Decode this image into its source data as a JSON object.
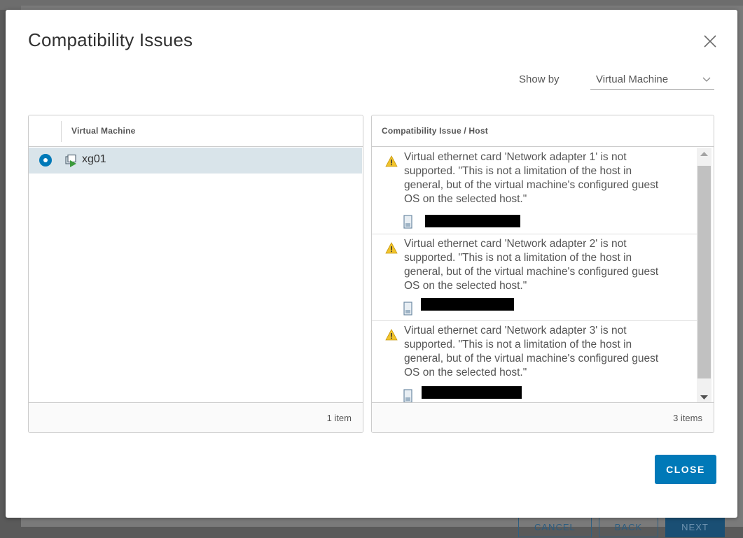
{
  "background": {
    "buttons": [
      "CANCEL",
      "BACK",
      "NEXT"
    ]
  },
  "dialog": {
    "title": "Compatibility Issues",
    "show_by": {
      "label": "Show by",
      "value": "Virtual Machine"
    },
    "close_button": "CLOSE"
  },
  "vm_panel": {
    "column_header": "Virtual Machine",
    "rows": [
      {
        "name": "xg01",
        "selected": true
      }
    ],
    "footer_count": "1 item"
  },
  "issues_panel": {
    "column_header": "Compatibility Issue / Host",
    "issues": [
      {
        "message": "Virtual ethernet card 'Network adapter 1' is not supported. \"This is not a limitation of the host in general, but of the virtual machine's configured guest OS on the selected host.\"",
        "icon": "warning-icon",
        "host_icon": "host-icon"
      },
      {
        "message": "Virtual ethernet card 'Network adapter 2' is not supported. \"This is not a limitation of the host in general, but of the virtual machine's configured guest OS on the selected host.\"",
        "icon": "warning-icon",
        "host_icon": "host-icon"
      },
      {
        "message": "Virtual ethernet card 'Network adapter 3' is not supported. \"This is not a limitation of the host in general, but of the virtual machine's configured guest OS on the selected host.\"",
        "icon": "warning-icon",
        "host_icon": "host-icon"
      }
    ],
    "footer_count": "3 items"
  },
  "colors": {
    "primary": "#0079b8",
    "selected_row": "#d9e4ea",
    "warning": "#f2c42c"
  }
}
